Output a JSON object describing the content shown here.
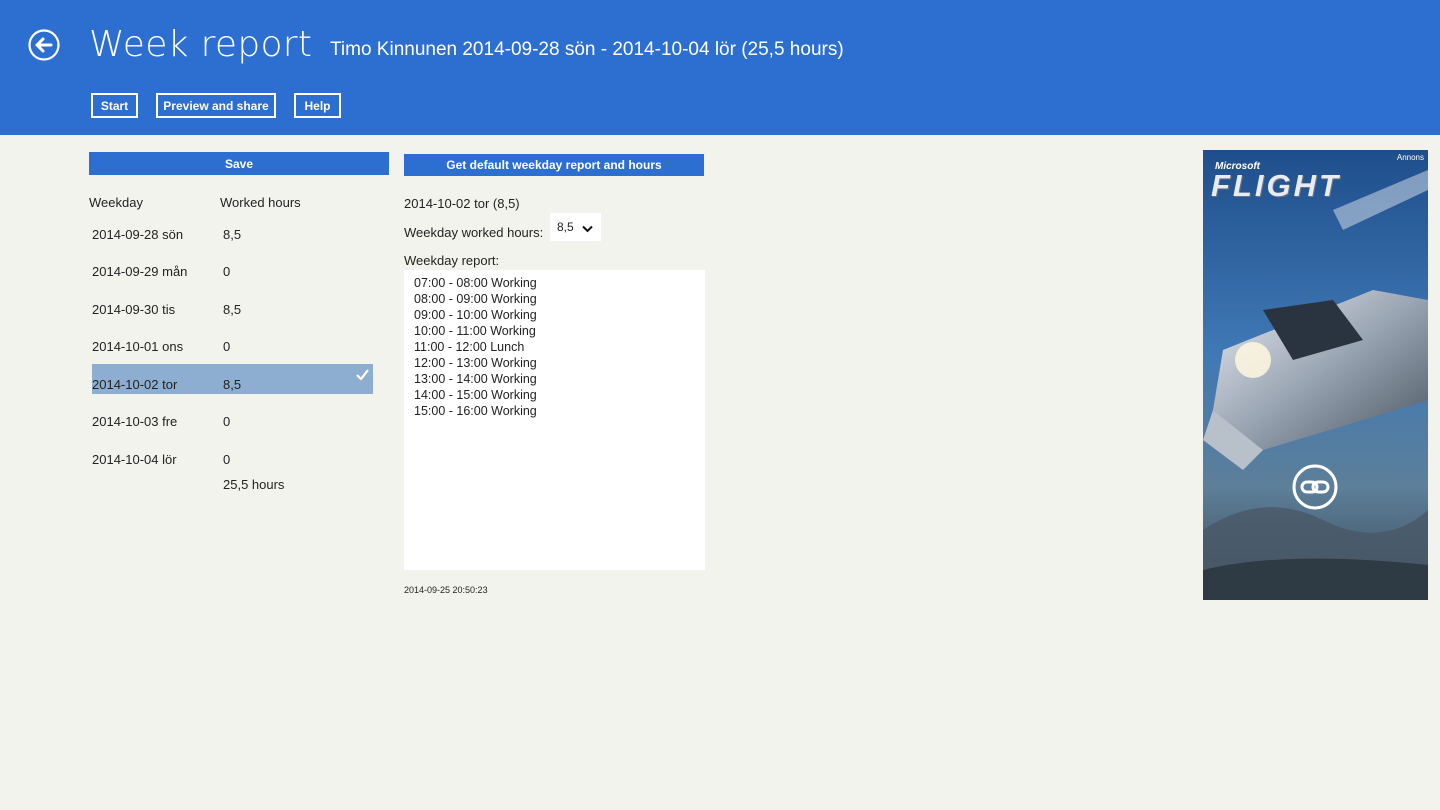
{
  "header": {
    "title": "Week report",
    "subtitle": "Timo Kinnunen 2014-09-28 sön - 2014-10-04 lör (25,5 hours)",
    "buttons": {
      "start": "Start",
      "preview_share": "Preview and share",
      "help": "Help"
    }
  },
  "left_panel": {
    "save_label": "Save",
    "col_weekday": "Weekday",
    "col_hours": "Worked hours",
    "rows": [
      {
        "day": "2014-09-28 sön",
        "hours": "8,5"
      },
      {
        "day": "2014-09-29 mån",
        "hours": "0"
      },
      {
        "day": "2014-09-30 tis",
        "hours": "8,5"
      },
      {
        "day": "2014-10-01 ons",
        "hours": "0"
      },
      {
        "day": "2014-10-02 tor",
        "hours": "8,5",
        "selected": true
      },
      {
        "day": "2014-10-03 fre",
        "hours": "0"
      },
      {
        "day": "2014-10-04 lör",
        "hours": "0"
      }
    ],
    "total": "25,5 hours"
  },
  "right_panel": {
    "get_default_label": "Get default weekday report and hours",
    "selected_day": "2014-10-02 tor (8,5)",
    "worked_hours_label": "Weekday worked hours:",
    "worked_hours_value": "8,5",
    "report_label": "Weekday report:",
    "report_lines": [
      "07:00 - 08:00 Working",
      "08:00 - 09:00 Working",
      "09:00 - 10:00 Working",
      "10:00 - 11:00 Working",
      "11:00 - 12:00 Lunch",
      "12:00 - 13:00 Working",
      "13:00 - 14:00 Working",
      "14:00 - 15:00 Working",
      "15:00 - 16:00 Working"
    ],
    "timestamp": "2014-09-25 20:50:23"
  },
  "ad": {
    "brand": "Microsoft",
    "title": "FLIGHT",
    "badge": "Annons"
  },
  "colors": {
    "accent": "#2d6fd1",
    "selected_row": "#8daed0",
    "background": "#f3f3ee"
  }
}
